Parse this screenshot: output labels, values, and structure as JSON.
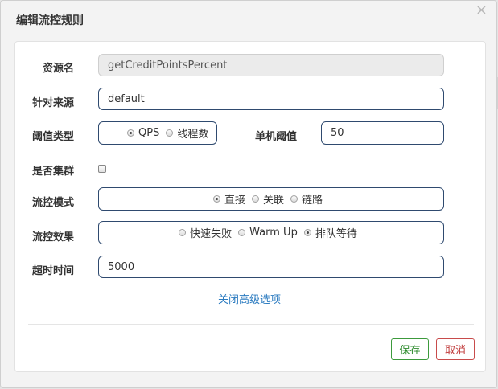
{
  "dialog": {
    "title": "编辑流控规则",
    "close_symbol": "×"
  },
  "form": {
    "resource": {
      "label": "资源名",
      "value": "getCreditPointsPercent"
    },
    "limit_app": {
      "label": "针对来源",
      "value": "default"
    },
    "grade": {
      "label": "阈值类型",
      "options": [
        {
          "label": "QPS",
          "checked": true
        },
        {
          "label": "线程数",
          "checked": false
        }
      ]
    },
    "count": {
      "label": "单机阈值",
      "value": "50"
    },
    "cluster": {
      "label": "是否集群",
      "checked": false
    },
    "strategy": {
      "label": "流控模式",
      "options": [
        {
          "label": "直接",
          "checked": true
        },
        {
          "label": "关联",
          "checked": false
        },
        {
          "label": "链路",
          "checked": false
        }
      ]
    },
    "control_behavior": {
      "label": "流控效果",
      "options": [
        {
          "label": "快速失败",
          "checked": false
        },
        {
          "label": "Warm Up",
          "checked": false
        },
        {
          "label": "排队等待",
          "checked": true
        }
      ]
    },
    "timeout": {
      "label": "超时时间",
      "value": "5000"
    },
    "advanced_link": "关闭高级选项"
  },
  "footer": {
    "save_label": "保存",
    "cancel_label": "取消"
  }
}
